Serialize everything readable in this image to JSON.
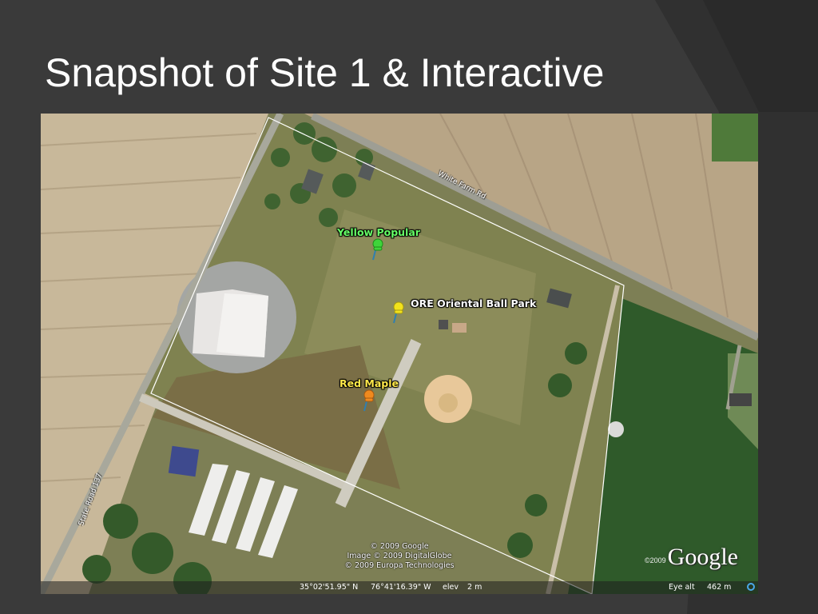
{
  "slide": {
    "title": "Snapshot of Site 1 & Interactive"
  },
  "map": {
    "road_labels": {
      "white_farm_rd": "White Farm Rd",
      "state_road": "State Road 137"
    },
    "placemarks": [
      {
        "label": "Yellow Popular",
        "color": "#3fd43a",
        "label_color": "#66ff66",
        "icon": "green-pushpin-icon"
      },
      {
        "label": "ORE Oriental Ball Park",
        "color": "#f2e21c",
        "label_color": "#ffffff",
        "icon": "yellow-pushpin-icon"
      },
      {
        "label": "Red Maple",
        "color": "#f08a1e",
        "label_color": "#ffe84a",
        "icon": "orange-pushpin-icon"
      }
    ],
    "copyright": [
      "© 2009 Google",
      "Image © 2009 DigitalGlobe",
      "© 2009 Europa Technologies"
    ],
    "logo_year": "©2009",
    "logo_text": "Google",
    "status": {
      "latitude": "35°02'51.95\" N",
      "longitude": "76°41'16.39\" W",
      "elev_label": "elev",
      "elev_value": "2 m",
      "eye_alt_label": "Eye alt",
      "eye_alt_value": "462 m"
    }
  }
}
